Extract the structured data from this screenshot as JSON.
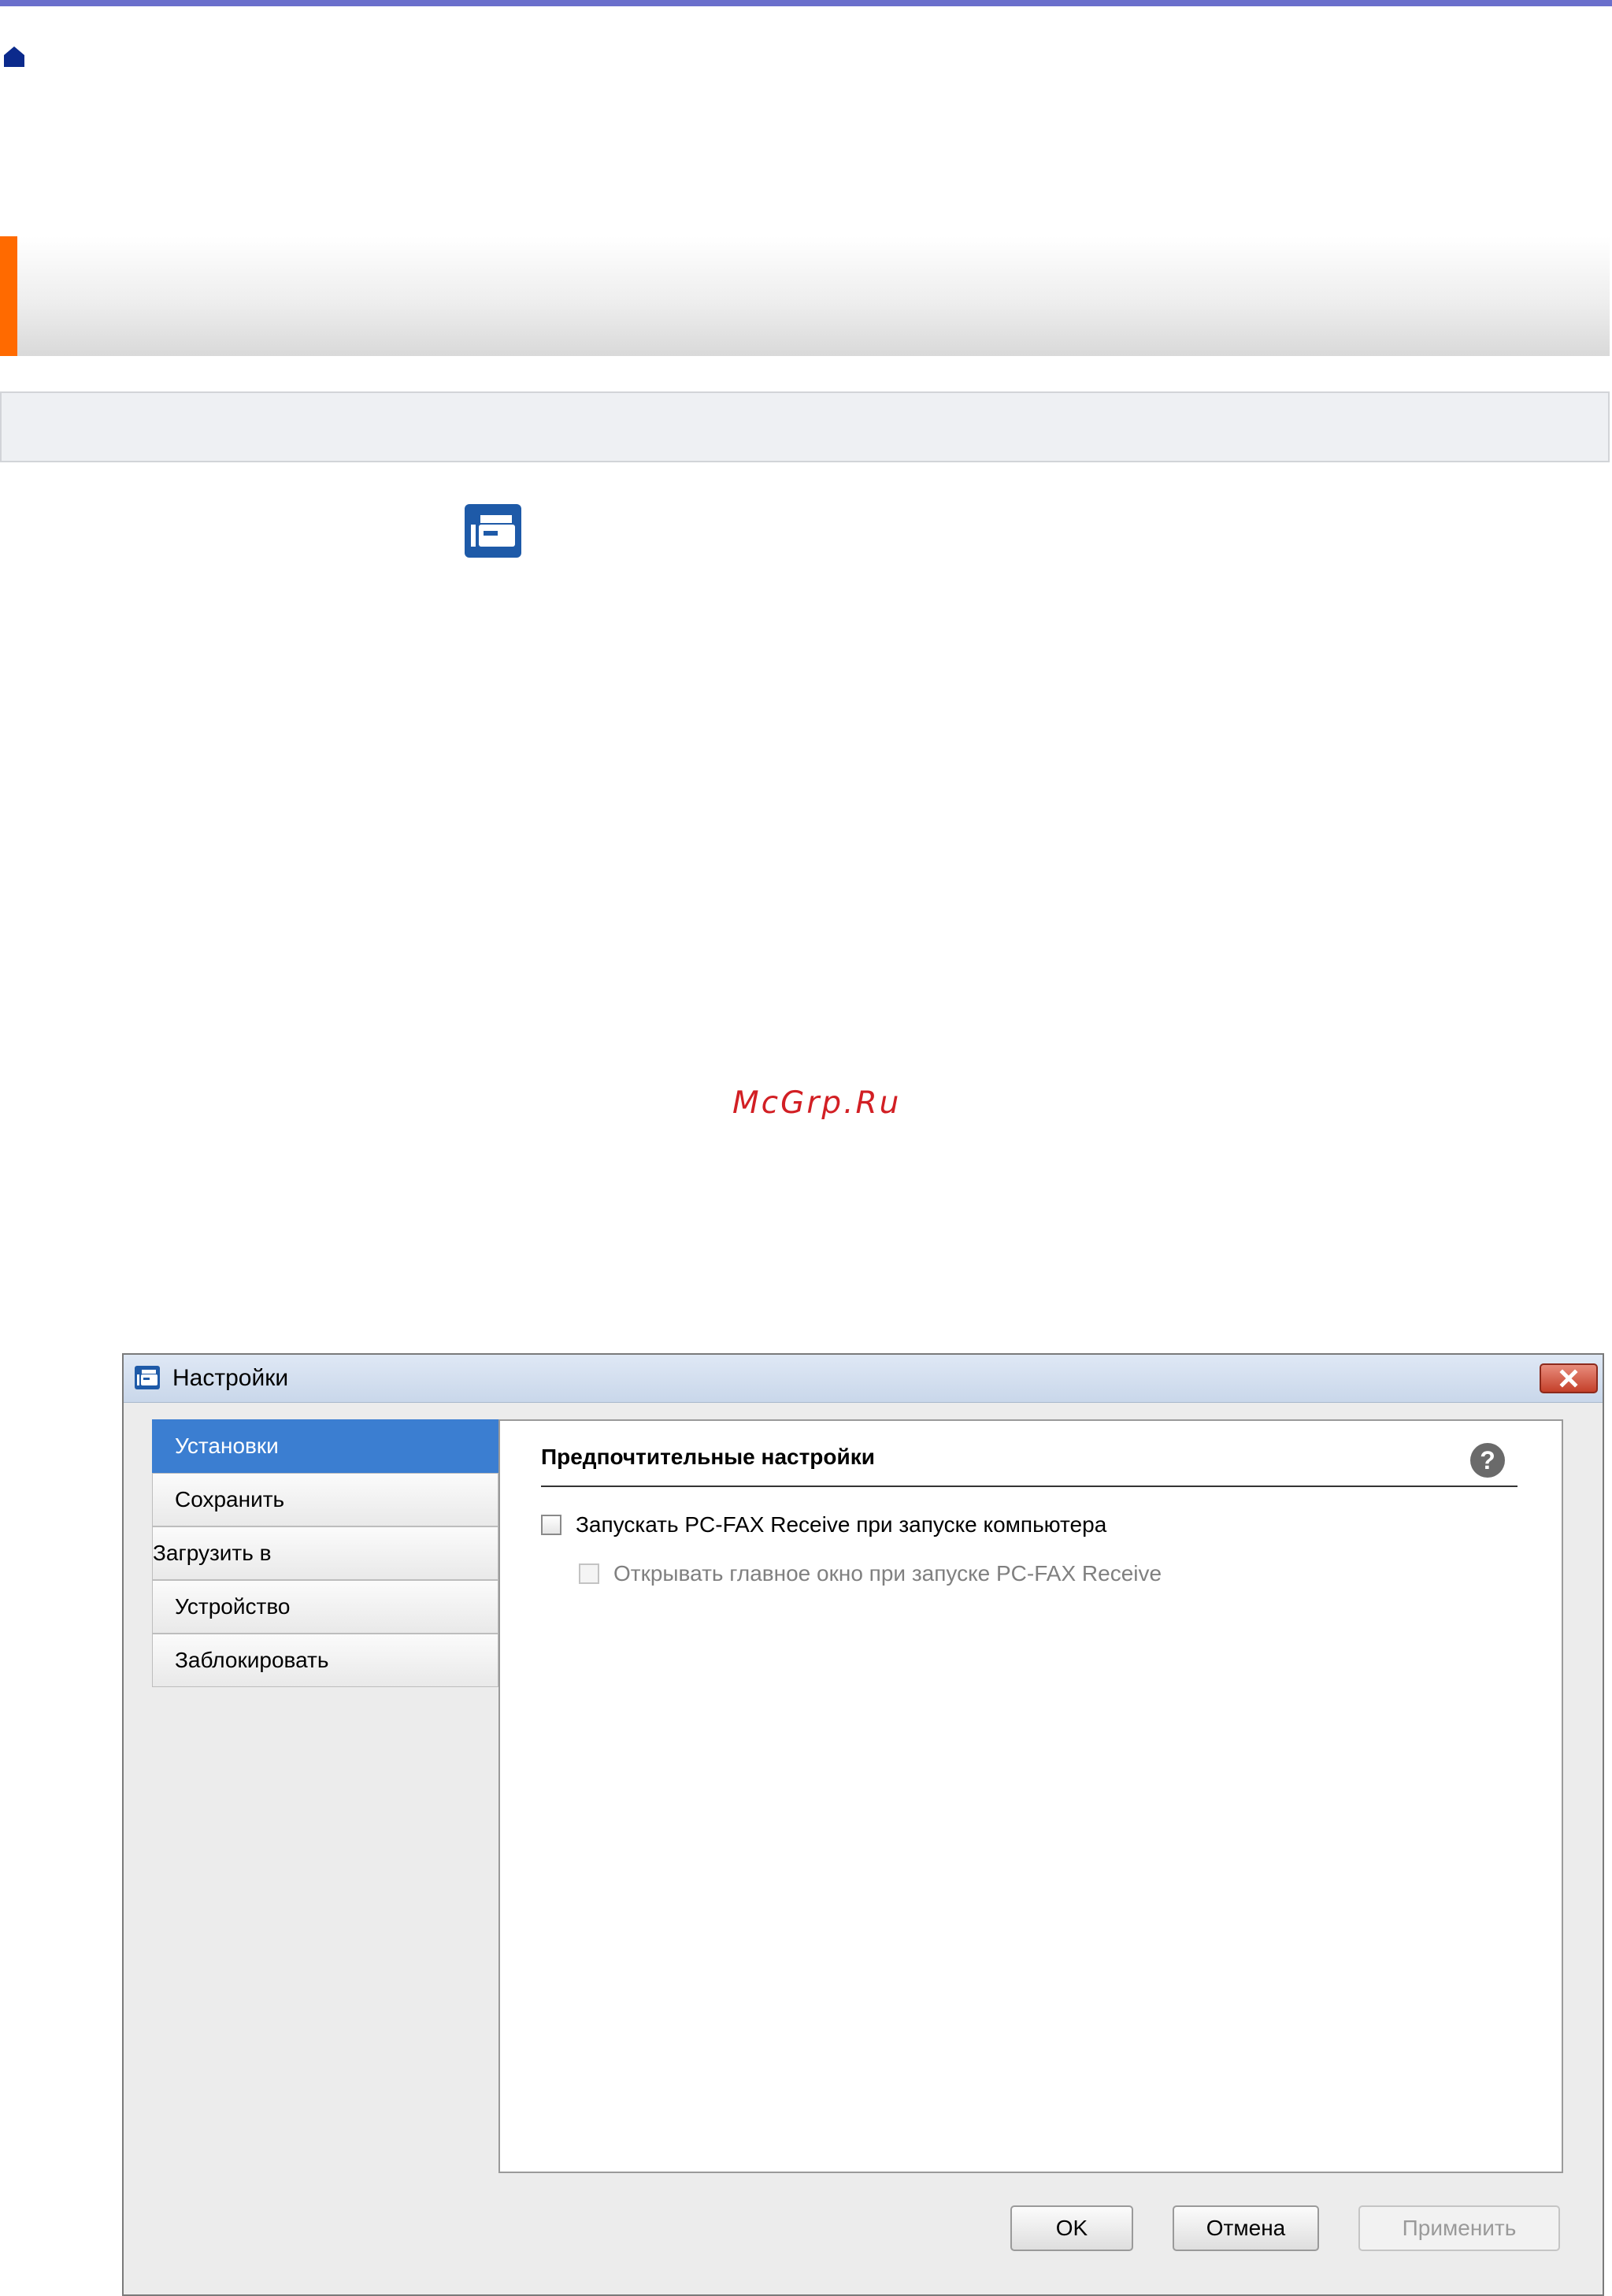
{
  "page": {
    "home_icon": "home-icon",
    "inline_icon": "pc-fax-receive-app-icon",
    "watermark": "McGrp.Ru",
    "colors": {
      "top_bar": "#6a6fcc",
      "title_accent": "#ff6a00",
      "watermark": "#d21f24",
      "selected_item": "#3b7ed1"
    }
  },
  "dialog": {
    "title": "Настройки",
    "window_icon": "pc-fax-receive-app-icon",
    "close_icon": "close-icon",
    "sidebar": {
      "items": [
        {
          "label": "Установки",
          "selected": true
        },
        {
          "label": "Сохранить",
          "selected": false
        },
        {
          "label": "Загрузить в",
          "selected": false
        },
        {
          "label": "Устройство",
          "selected": false
        },
        {
          "label": "Заблокировать",
          "selected": false
        }
      ]
    },
    "content": {
      "section_title": "Предпочтительные настройки",
      "help_icon": "question-icon",
      "help_glyph": "?",
      "checkboxes": [
        {
          "label": "Запускать PC-FAX Receive при запуске компьютера",
          "checked": false,
          "enabled": true
        },
        {
          "label": "Открывать главное окно при запуске PC-FAX Receive",
          "checked": false,
          "enabled": false
        }
      ]
    },
    "buttons": {
      "ok": "OK",
      "cancel": "Отмена",
      "apply": "Применить"
    }
  }
}
